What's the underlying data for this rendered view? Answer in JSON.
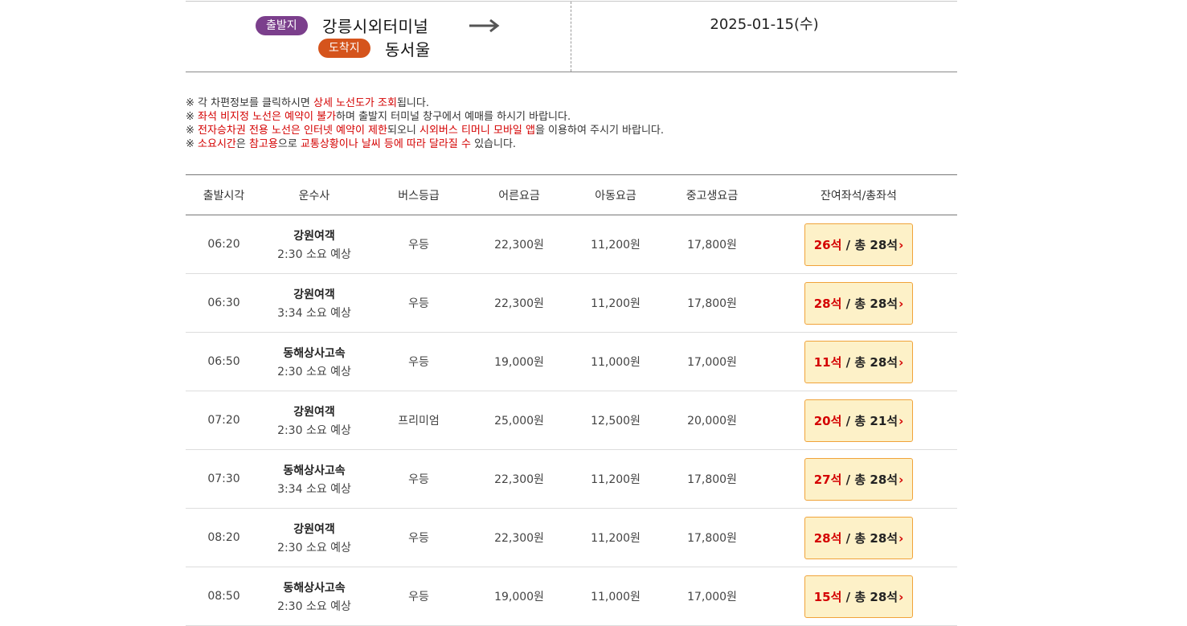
{
  "route": {
    "departure_badge": "출발지",
    "departure_terminal": "강릉시외터미널",
    "arrival_badge": "도착지",
    "arrival_terminal": "동서울",
    "date": "2025-01-15(수)"
  },
  "notices": [
    [
      {
        "t": "※ 각 차편정보를 클릭하시면 ",
        "red": false
      },
      {
        "t": "상세 노선도가 조회",
        "red": true
      },
      {
        "t": "됩니다.",
        "red": false
      }
    ],
    [
      {
        "t": "※ ",
        "red": false
      },
      {
        "t": "좌석 비지정 노선은 예약이 불가",
        "red": true
      },
      {
        "t": "하며 출발지 터미널 창구에서 예매를 하시기 바랍니다.",
        "red": false
      }
    ],
    [
      {
        "t": "※ ",
        "red": false
      },
      {
        "t": "전자승차권 전용 노선은 인터넷 예약이 제한",
        "red": true
      },
      {
        "t": "되오니 ",
        "red": false
      },
      {
        "t": "시외버스 티머니 모바일 앱",
        "red": true
      },
      {
        "t": "을 이용하여 주시기 바랍니다.",
        "red": false
      }
    ],
    [
      {
        "t": "※ ",
        "red": false
      },
      {
        "t": "소요시간",
        "red": true
      },
      {
        "t": "은 ",
        "red": false
      },
      {
        "t": "참고용",
        "red": true
      },
      {
        "t": "으로 ",
        "red": false
      },
      {
        "t": "교통상황이나 날씨 등에 따라 달라질 수",
        "red": true
      },
      {
        "t": " 있습니다.",
        "red": false
      }
    ]
  ],
  "table": {
    "headers": {
      "time": "출발시각",
      "operator": "운수사",
      "grade": "버스등급",
      "adult": "어른요금",
      "child": "아동요금",
      "teen": "중고생요금",
      "seats": "잔여좌석/총좌석"
    },
    "rows": [
      {
        "time": "06:20",
        "operator": "강원여객",
        "duration": "2:30 소요 예상",
        "grade": "우등",
        "adult": "22,300원",
        "child": "11,200원",
        "teen": "17,800원",
        "remaining": "26석",
        "total": " / 총 28석"
      },
      {
        "time": "06:30",
        "operator": "강원여객",
        "duration": "3:34 소요 예상",
        "grade": "우등",
        "adult": "22,300원",
        "child": "11,200원",
        "teen": "17,800원",
        "remaining": "28석",
        "total": " / 총 28석"
      },
      {
        "time": "06:50",
        "operator": "동해상사고속",
        "duration": "2:30 소요 예상",
        "grade": "우등",
        "adult": "19,000원",
        "child": "11,000원",
        "teen": "17,000원",
        "remaining": "11석",
        "total": " / 총 28석"
      },
      {
        "time": "07:20",
        "operator": "강원여객",
        "duration": "2:30 소요 예상",
        "grade": "프리미엄",
        "adult": "25,000원",
        "child": "12,500원",
        "teen": "20,000원",
        "remaining": "20석",
        "total": " / 총 21석"
      },
      {
        "time": "07:30",
        "operator": "동해상사고속",
        "duration": "3:34 소요 예상",
        "grade": "우등",
        "adult": "22,300원",
        "child": "11,200원",
        "teen": "17,800원",
        "remaining": "27석",
        "total": " / 총 28석"
      },
      {
        "time": "08:20",
        "operator": "강원여객",
        "duration": "2:30 소요 예상",
        "grade": "우등",
        "adult": "22,300원",
        "child": "11,200원",
        "teen": "17,800원",
        "remaining": "28석",
        "total": " / 총 28석"
      },
      {
        "time": "08:50",
        "operator": "동해상사고속",
        "duration": "2:30 소요 예상",
        "grade": "우등",
        "adult": "19,000원",
        "child": "11,000원",
        "teen": "17,000원",
        "remaining": "15석",
        "total": " / 총 28석"
      }
    ]
  },
  "icons": {
    "route_arrow": "right-arrow-icon",
    "seat_chevron": "chevron-right-icon"
  },
  "colors": {
    "departure_badge": "#7b3f8c",
    "arrival_badge": "#d5541c",
    "notice_highlight": "#d40000",
    "seat_button_bg": "#fdf1c8",
    "seat_button_border": "#f0a33a"
  }
}
